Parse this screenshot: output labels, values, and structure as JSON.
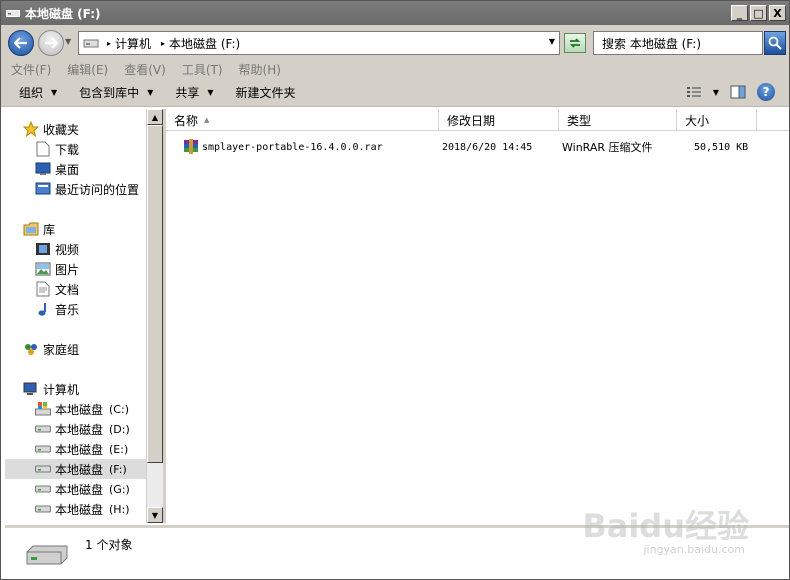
{
  "window": {
    "title": "本地磁盘 (F:)",
    "minimize": "_",
    "maximize": "□",
    "close": "X"
  },
  "address": {
    "segments": [
      "计算机",
      "本地磁盘 (F:)"
    ],
    "search_placeholder": "搜索 本地磁盘 (F:)"
  },
  "menu": [
    "文件(F)",
    "编辑(E)",
    "查看(V)",
    "工具(T)",
    "帮助(H)"
  ],
  "commands": {
    "organize": "组织",
    "include_library": "包含到库中",
    "share": "共享",
    "new_folder": "新建文件夹"
  },
  "nav": {
    "favorites": "收藏夹",
    "favorites_items": [
      "下载",
      "桌面",
      "最近访问的位置"
    ],
    "libraries": "库",
    "library_items": [
      "视频",
      "图片",
      "文档",
      "音乐"
    ],
    "homegroup": "家庭组",
    "computer": "计算机",
    "drives": [
      {
        "label": "本地磁盘",
        "letter": "(C:)"
      },
      {
        "label": "本地磁盘",
        "letter": "(D:)"
      },
      {
        "label": "本地磁盘",
        "letter": "(E:)"
      },
      {
        "label": "本地磁盘",
        "letter": "(F:)"
      },
      {
        "label": "本地磁盘",
        "letter": "(G:)"
      },
      {
        "label": "本地磁盘",
        "letter": "(H:)"
      }
    ]
  },
  "columns": {
    "name": "名称",
    "date": "修改日期",
    "type": "类型",
    "size": "大小"
  },
  "files": [
    {
      "name": "smplayer-portable-16.4.0.0.rar",
      "date": "2018/6/20 14:45",
      "type": "WinRAR 压缩文件",
      "size": "50,510 KB"
    }
  ],
  "status": {
    "count": "1 个对象"
  },
  "watermark": {
    "brand": "Baidu经验",
    "url": "jingyan.baidu.com"
  },
  "colors": {
    "titlebar": "#6a6a6a",
    "selection": "#dcdcdc",
    "accent_blue": "#1c4f9c"
  }
}
